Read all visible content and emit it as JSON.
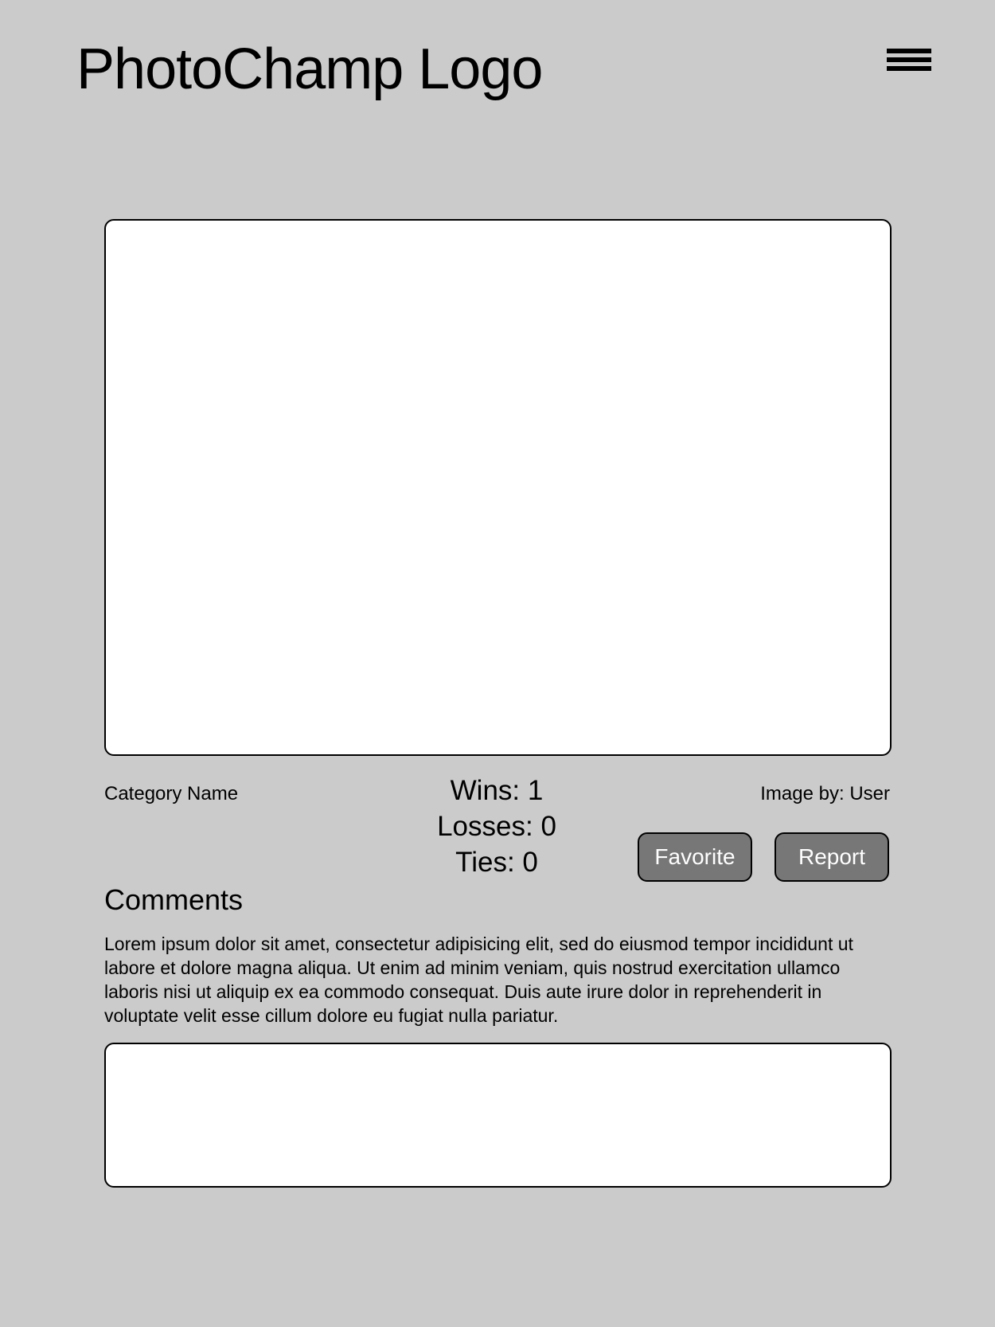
{
  "header": {
    "logo_text": "PhotoChamp Logo",
    "menu_icon": "hamburger-menu-icon"
  },
  "photo": {
    "category": "Category Name",
    "credit": "Image by: User"
  },
  "stats": {
    "wins": "Wins: 1",
    "losses": "Losses: 0",
    "ties": "Ties: 0"
  },
  "actions": {
    "favorite_label": "Favorite",
    "report_label": "Report"
  },
  "comments": {
    "title": "Comments",
    "body": "Lorem ipsum dolor sit amet, consectetur adipisicing elit, sed do eiusmod tempor incididunt ut labore et dolore magna aliqua. Ut enim ad minim veniam, quis nostrud exercitation ullamco laboris nisi ut aliquip ex ea commodo consequat. Duis aute irure dolor in reprehenderit in voluptate velit esse cillum dolore eu fugiat nulla pariatur.",
    "input_value": ""
  },
  "colors": {
    "background": "#cbcbcb",
    "panel": "#ffffff",
    "button": "#777777",
    "button_text": "#ffffff"
  }
}
